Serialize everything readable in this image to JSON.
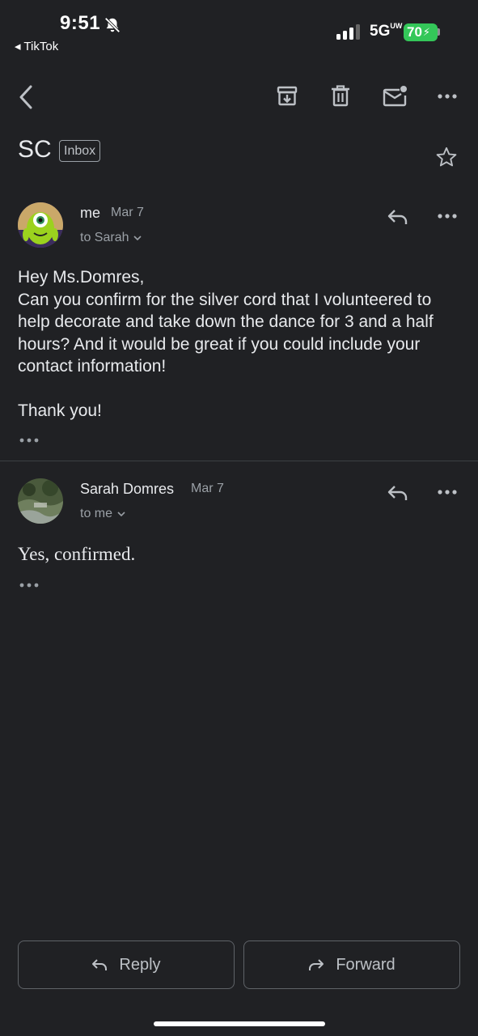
{
  "status_bar": {
    "time": "9:51",
    "back_app": "◂ TikTok",
    "network": "5G",
    "network_superscript": "UW",
    "battery": "70"
  },
  "toolbar": {
    "icons": [
      "back-arrow-icon",
      "archive-icon",
      "trash-icon",
      "mark-unread-icon",
      "more-horizontal-icon"
    ]
  },
  "thread": {
    "subject": "SC",
    "label": "Inbox"
  },
  "messages": [
    {
      "sender": "me",
      "date": "Mar 7",
      "recipient": "to Sarah",
      "body": "Hey Ms.Domres,\nCan you confirm for the silver cord that I volunteered to help decorate and take down the dance for 3 and a half hours? And it would be great if you could include your contact information!\n\nThank you!"
    },
    {
      "sender": "Sarah Domres",
      "date": "Mar 7",
      "recipient": "to me",
      "body": "Yes, confirmed."
    }
  ],
  "actions": {
    "reply": "Reply",
    "forward": "Forward"
  },
  "colors": {
    "background": "#202124",
    "text": "#e8eaed",
    "muted": "#9aa0a6",
    "battery": "#34c759"
  }
}
